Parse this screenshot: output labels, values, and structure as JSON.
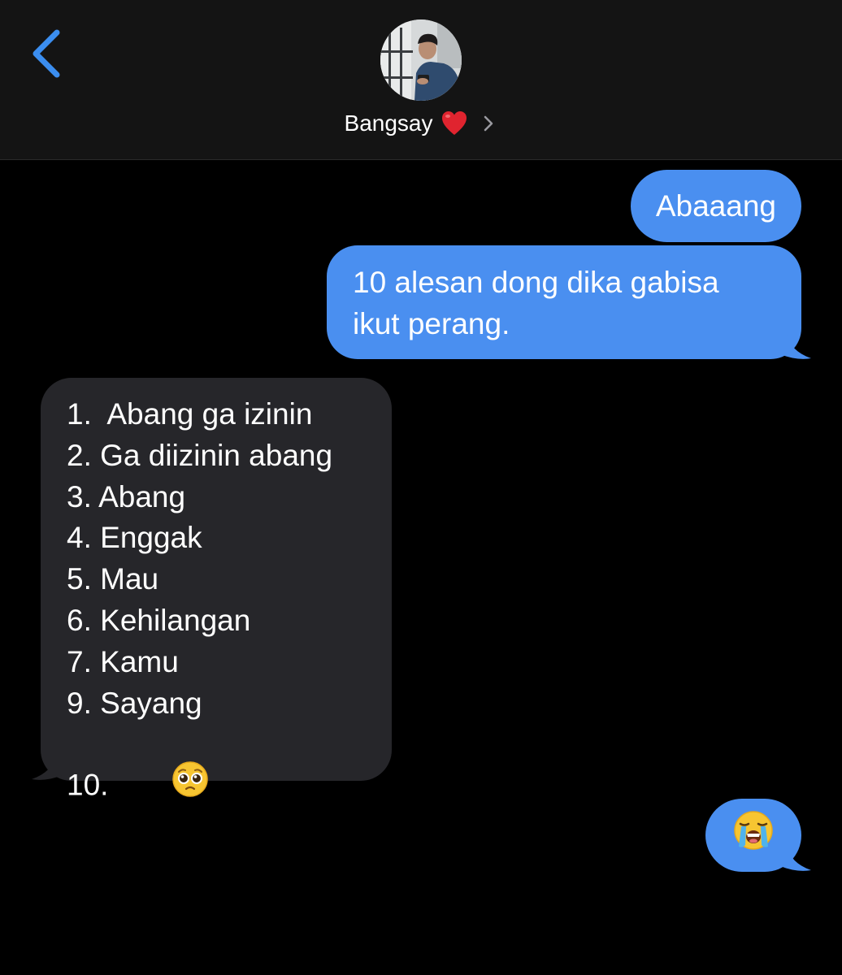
{
  "header": {
    "contact_name": "Bangsay",
    "heart_emoji": "❤️"
  },
  "messages": [
    {
      "direction": "outgoing",
      "text": "Abaaang"
    },
    {
      "direction": "outgoing",
      "lines": [
        "10 alesan dong dika gabisa",
        "ikut perang."
      ]
    },
    {
      "direction": "incoming",
      "lines": [
        "1.  Abang ga izinin",
        "2. Ga diizinin abang",
        "3. Abang",
        "4. Enggak",
        "5. Mau",
        "6. Kehilangan",
        "7. Kamu",
        "9. Sayang",
        "10. "
      ],
      "trailing_emoji": "pleading-face"
    },
    {
      "direction": "outgoing",
      "emoji": "loudly-crying-face"
    }
  ],
  "colors": {
    "outgoing_bubble": "#4a8ff0",
    "incoming_bubble": "#26262a",
    "accent_back": "#3b8ef0",
    "background": "#000000",
    "header_bg": "#141414"
  }
}
